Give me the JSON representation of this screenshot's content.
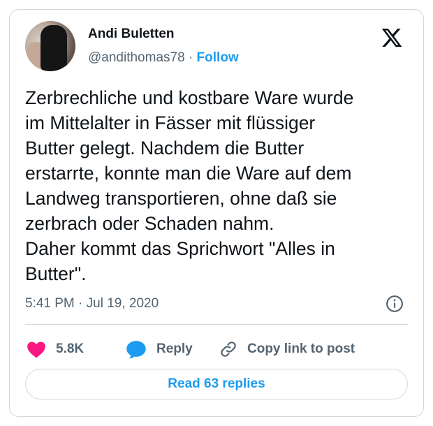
{
  "author": {
    "name": "Andi Buletten",
    "handle": "@andithomas78",
    "separator": "·",
    "follow_label": "Follow"
  },
  "tweet": {
    "lines": [
      "Zerbrechliche und kostbare Ware wurde",
      "im Mittelalter in Fässer mit flüssiger",
      "Butter gelegt. Nachdem die Butter",
      "erstarrte, konnte man die Ware auf dem",
      "Landweg transportieren, ohne daß sie",
      "zerbrach oder Schaden nahm.",
      "Daher kommt das Sprichwort \"Alles in",
      "Butter\"."
    ],
    "timestamp": "5:41 PM · Jul 19, 2020"
  },
  "actions": {
    "likes": "5.8K",
    "reply_label": "Reply",
    "copy_link_label": "Copy link to post"
  },
  "read_replies_label": "Read 63 replies",
  "icons": {
    "platform": "x-logo-icon",
    "info": "info-icon",
    "like": "heart-icon",
    "reply": "speech-bubble-icon",
    "copy": "link-icon"
  },
  "colors": {
    "accent": "#1d9bf0",
    "heart": "#f91880",
    "muted": "#536471",
    "text": "#0f1419",
    "border": "#cfd9de"
  }
}
